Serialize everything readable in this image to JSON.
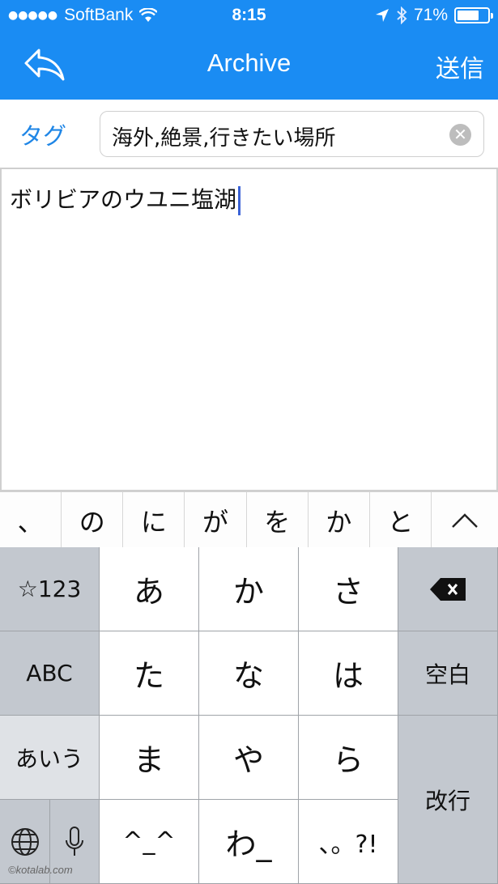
{
  "status": {
    "signal_dots": "●●●●●",
    "carrier": "SoftBank",
    "time": "8:15",
    "battery_percent_text": "71%",
    "battery_level": 0.71
  },
  "nav": {
    "title": "Archive",
    "send_label": "送信"
  },
  "tag": {
    "label": "タグ",
    "value": "海外,絶景,行きたい場所",
    "clear_glyph": "✕"
  },
  "body_text": "ボリビアのウユニ塩湖",
  "candidates": [
    "、",
    "の",
    "に",
    "が",
    "を",
    "か",
    "と"
  ],
  "keyboard": {
    "numeric_key": "☆123",
    "abc_key": "ABC",
    "kana_mode_key": "あいう",
    "space_key": "空白",
    "return_key": "改行",
    "rows": [
      [
        "あ",
        "か",
        "さ"
      ],
      [
        "た",
        "な",
        "は"
      ],
      [
        "ま",
        "や",
        "ら"
      ],
      [
        "^_^",
        "わ_",
        "、。?!"
      ]
    ]
  },
  "watermark": "©kotalab.com",
  "colors": {
    "accent": "#1a8cf3",
    "tag_label": "#1f86e6",
    "keyboard_bg": "#d0d4d9"
  }
}
